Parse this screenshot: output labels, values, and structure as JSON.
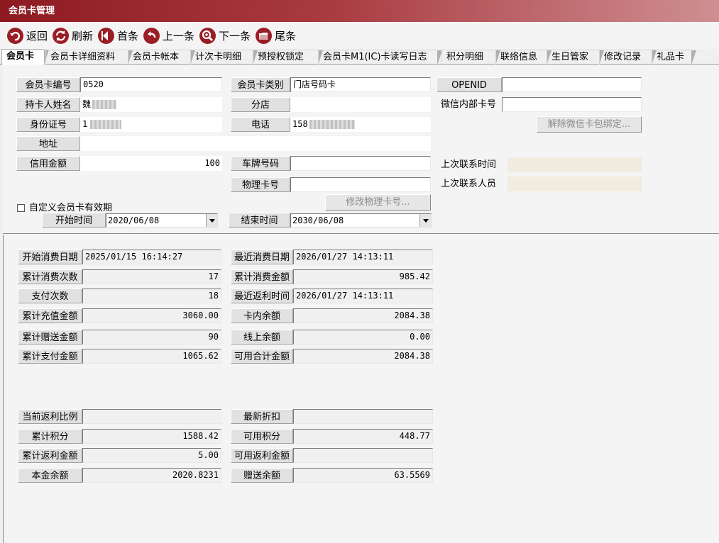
{
  "window": {
    "title": "会员卡管理"
  },
  "toolbar": [
    {
      "label": "返回",
      "icon": "undo-icon"
    },
    {
      "label": "刷新",
      "icon": "refresh-icon"
    },
    {
      "label": "首条",
      "icon": "first-record-icon"
    },
    {
      "label": "上一条",
      "icon": "previous-record-icon"
    },
    {
      "label": "下一条",
      "icon": "next-record-icon"
    },
    {
      "label": "尾条",
      "icon": "last-record-icon"
    }
  ],
  "tabs": [
    "会员卡",
    "会员卡详细资料",
    "会员卡帐本",
    "计次卡明细",
    "预授权锁定",
    "会员卡M1(IC)卡读写日志",
    "积分明细",
    "联络信息",
    "生日管家",
    "修改记录",
    "礼品卡"
  ],
  "card": {
    "card_no_label": "会员卡编号",
    "card_no": "0520",
    "card_type_label": "会员卡类别",
    "card_type": "门店号码卡",
    "openid_label": "OPENID",
    "openid": "",
    "holder_label": "持卡人姓名",
    "holder": "魏",
    "branch_label": "分店",
    "branch": "",
    "wechat_card_label": "微信内部卡号",
    "wechat_card": "",
    "id_label": "身份证号",
    "id_no": "1",
    "phone_label": "电话",
    "phone": "158",
    "unbind_button": "解除微信卡包绑定...",
    "address_label": "地址",
    "address": "",
    "credit_label": "信用金额",
    "credit": "100",
    "plate_label": "车牌号码",
    "plate": "",
    "last_contact_time_label": "上次联系时间",
    "last_contact_time": "",
    "physical_card_label": "物理卡号",
    "physical_card": "",
    "last_contact_person_label": "上次联系人员",
    "last_contact_person": "",
    "modify_physical_button": "修改物理卡号...",
    "custom_validity_label": "自定义会员卡有效期",
    "start_label": "开始时间",
    "start_date": "2020/06/08",
    "end_label": "结束时间",
    "end_date": "2030/06/08"
  },
  "stats": {
    "first_consume_label": "开始消费日期",
    "first_consume": "2025/01/15 16:14:27",
    "last_consume_label": "最近消费日期",
    "last_consume": "2026/01/27 14:13:11",
    "consume_count_label": "累计消费次数",
    "consume_count": "17",
    "consume_amount_label": "累计消费金额",
    "consume_amount": "985.42",
    "pay_count_label": "支付次数",
    "pay_count": "18",
    "last_rebate_time_label": "最近返利时间",
    "last_rebate_time": "2026/01/27 14:13:11",
    "recharge_label": "累计充值金额",
    "recharge": "3060.00",
    "card_balance_label": "卡内余额",
    "card_balance": "2084.38",
    "gift_amount_label": "累计赠送金额",
    "gift_amount": "90",
    "online_balance_label": "线上余额",
    "online_balance": "0.00",
    "pay_amount_label": "累计支付金额",
    "pay_amount": "1065.62",
    "available_total_label": "可用合计金额",
    "available_total": "2084.38",
    "rebate_ratio_label": "当前返利比例",
    "rebate_ratio": "",
    "latest_discount_label": "最新折扣",
    "latest_discount": "",
    "points_label": "累计积分",
    "points": "1588.42",
    "available_points_label": "可用积分",
    "available_points": "448.77",
    "rebate_amount_label": "累计返利金额",
    "rebate_amount": "5.00",
    "available_rebate_label": "可用返利金额",
    "available_rebate": "",
    "principal_label": "本金余额",
    "principal": "2020.8231",
    "gift_balance_label": "赠送余额",
    "gift_balance": "63.5569"
  }
}
